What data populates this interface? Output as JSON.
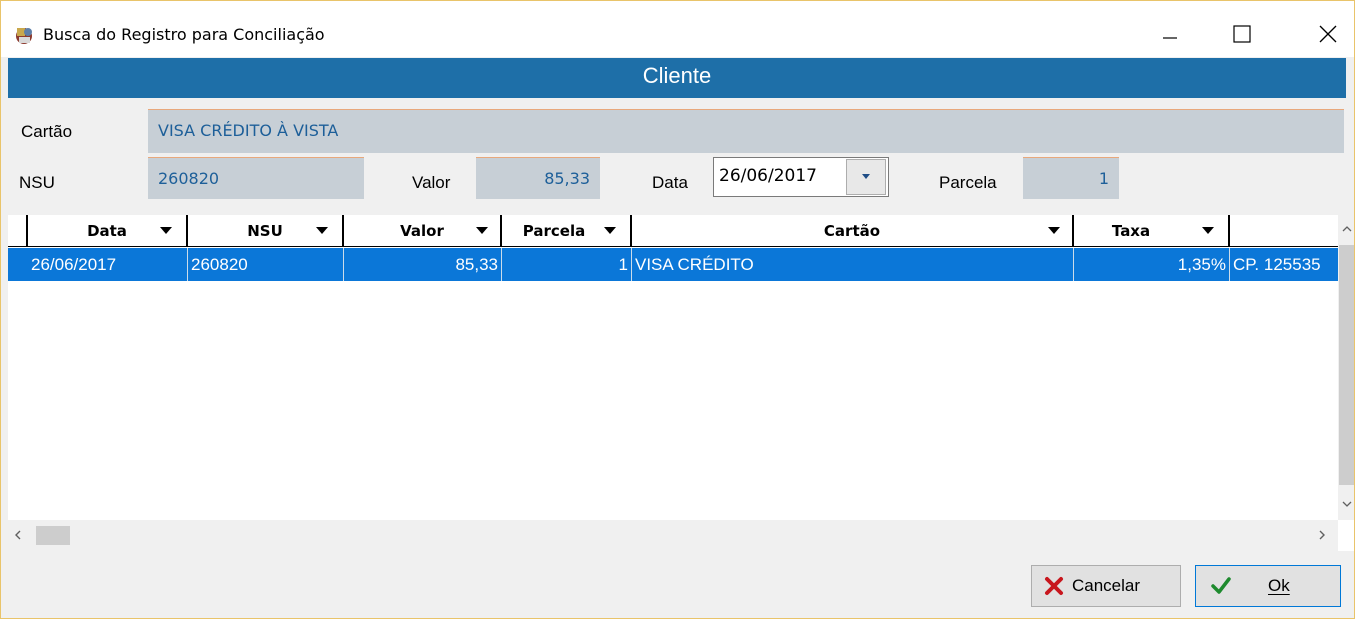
{
  "window": {
    "title": "Busca do Registro para Conciliação",
    "minimize_label": "minimize",
    "maximize_label": "maximize",
    "close_label": "close"
  },
  "section": {
    "title": "Cliente"
  },
  "form": {
    "cartao_label": "Cartão",
    "cartao_value": "VISA CRÉDITO À VISTA",
    "nsu_label": "NSU",
    "nsu_value": "260820",
    "valor_label": "Valor",
    "valor_value": "85,33",
    "data_label": "Data",
    "data_value": "26/06/2017",
    "parcela_label": "Parcela",
    "parcela_value": "1"
  },
  "grid": {
    "columns": [
      "Data",
      "NSU",
      "Valor",
      "Parcela",
      "Cartão",
      "Taxa",
      ""
    ],
    "rows": [
      {
        "data": "26/06/2017",
        "nsu": "260820",
        "valor": "85,33",
        "parcela": "1",
        "cartao": "VISA CRÉDITO",
        "taxa": "1,35%",
        "extra": "CP. 125535"
      }
    ]
  },
  "buttons": {
    "cancel_label": "Cancelar",
    "ok_label": "Ok"
  },
  "colors": {
    "header_band": "#1e6fa8",
    "selected_row": "#0b77d8",
    "field_bg": "#c7cfd6",
    "field_text": "#1d5f99"
  }
}
